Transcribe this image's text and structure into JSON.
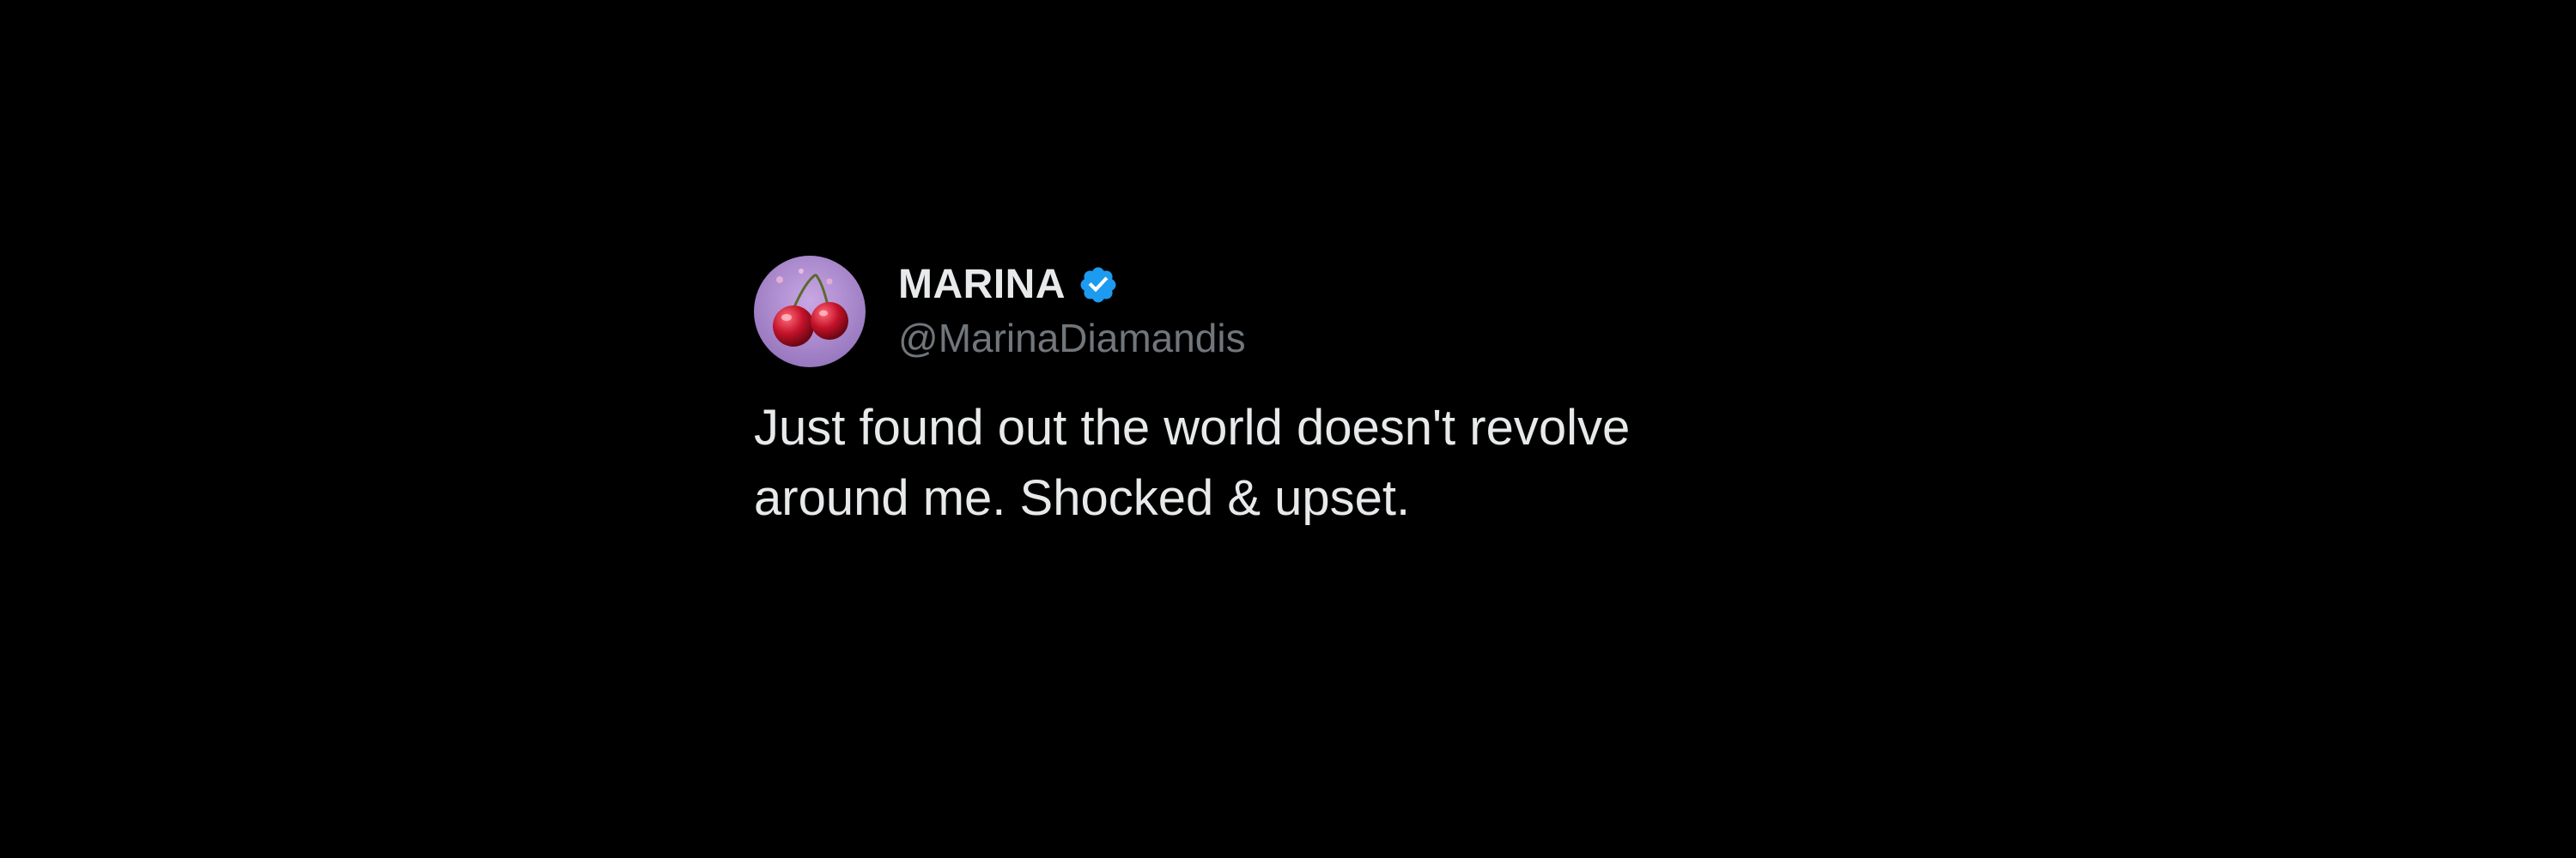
{
  "tweet": {
    "display_name": "MARINA",
    "handle": "@MarinaDiamandis",
    "verified": true,
    "text": "Just found out the world doesn't revolve around me. Shocked & upset.",
    "avatar_icon": "cherries-avatar-icon",
    "verified_icon": "verified-badge-icon"
  },
  "colors": {
    "background": "#000000",
    "text_primary": "#e7e9ea",
    "text_secondary": "#71767b",
    "verified_blue": "#1d9bf0"
  }
}
